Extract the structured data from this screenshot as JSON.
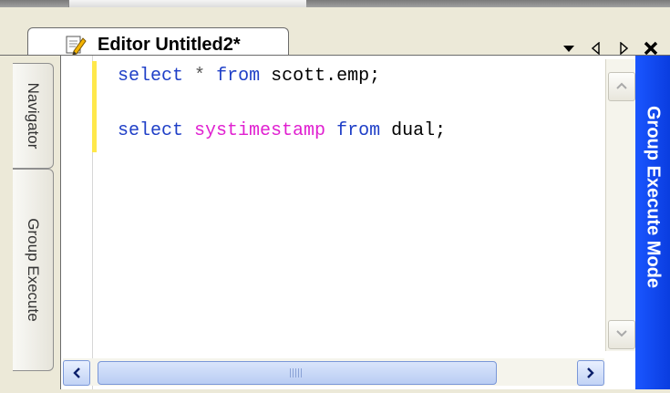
{
  "editor_tab": {
    "title": "Editor Untitled2*",
    "icon": "document-edit-icon"
  },
  "tab_controls": {
    "menu_icon": "dropdown-arrow-icon",
    "prev_icon": "chevron-left-icon",
    "next_icon": "chevron-right-icon",
    "close_icon": "close-icon"
  },
  "side_tabs": {
    "navigator": "Navigator",
    "group_execute": "Group Execute"
  },
  "right_panel": {
    "label": "Group Execute Mode"
  },
  "code_lines": [
    {
      "tokens": [
        {
          "text": "select",
          "kind": "keyword"
        },
        {
          "text": " ",
          "kind": "space"
        },
        {
          "text": "*",
          "kind": "operator"
        },
        {
          "text": " ",
          "kind": "space"
        },
        {
          "text": "from",
          "kind": "keyword"
        },
        {
          "text": " scott.emp;",
          "kind": "identifier"
        }
      ]
    },
    {
      "tokens": []
    },
    {
      "tokens": [
        {
          "text": "select",
          "kind": "keyword"
        },
        {
          "text": " ",
          "kind": "space"
        },
        {
          "text": "systimestamp",
          "kind": "function"
        },
        {
          "text": " ",
          "kind": "space"
        },
        {
          "text": "from",
          "kind": "keyword"
        },
        {
          "text": " dual;",
          "kind": "identifier"
        }
      ]
    }
  ],
  "colors": {
    "keyword": "#1f3fc7",
    "function": "#e020d0",
    "identifier": "#000000",
    "right_panel": "#1a56ff",
    "gutter_marker": "#ffe84a"
  }
}
